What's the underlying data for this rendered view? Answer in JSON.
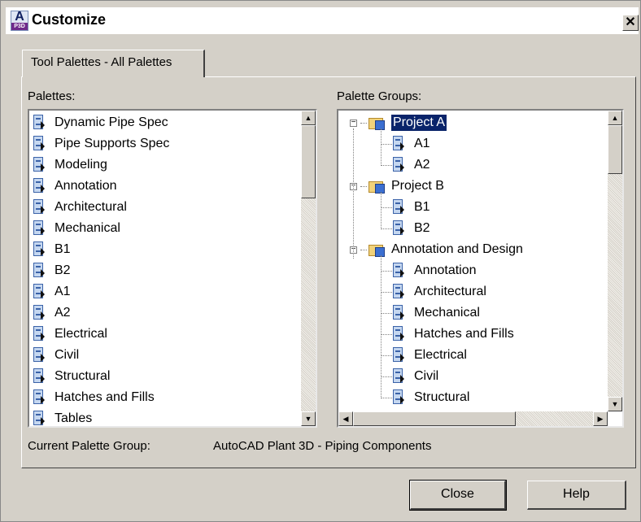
{
  "window": {
    "title": "Customize",
    "app_icon_letter": "A",
    "app_icon_sub": "P3D",
    "close_glyph": "✕"
  },
  "tab": {
    "label": "Tool Palettes - All Palettes"
  },
  "palettes": {
    "label": "Palettes:",
    "items": [
      "Dynamic Pipe Spec",
      "Pipe Supports Spec",
      "Modeling",
      "Annotation",
      "Architectural",
      "Mechanical",
      "B1",
      "B2",
      "A1",
      "A2",
      "Electrical",
      "Civil",
      "Structural",
      "Hatches and Fills",
      "Tables"
    ]
  },
  "groups": {
    "label": "Palette Groups:",
    "tree": [
      {
        "label": "Project A",
        "selected": true,
        "children": [
          "A1",
          "A2"
        ]
      },
      {
        "label": "Project B",
        "children": [
          "B1",
          "B2"
        ]
      },
      {
        "label": "Annotation and Design",
        "children": [
          "Annotation",
          "Architectural",
          "Mechanical",
          "Hatches and Fills",
          "Electrical",
          "Civil",
          "Structural"
        ]
      }
    ]
  },
  "current_group": {
    "label": "Current Palette Group:",
    "value": "AutoCAD Plant 3D - Piping Components"
  },
  "buttons": {
    "close": "Close",
    "help": "Help"
  },
  "colors": {
    "selection": "#0a246a",
    "dialog": "#d4d0c8"
  }
}
